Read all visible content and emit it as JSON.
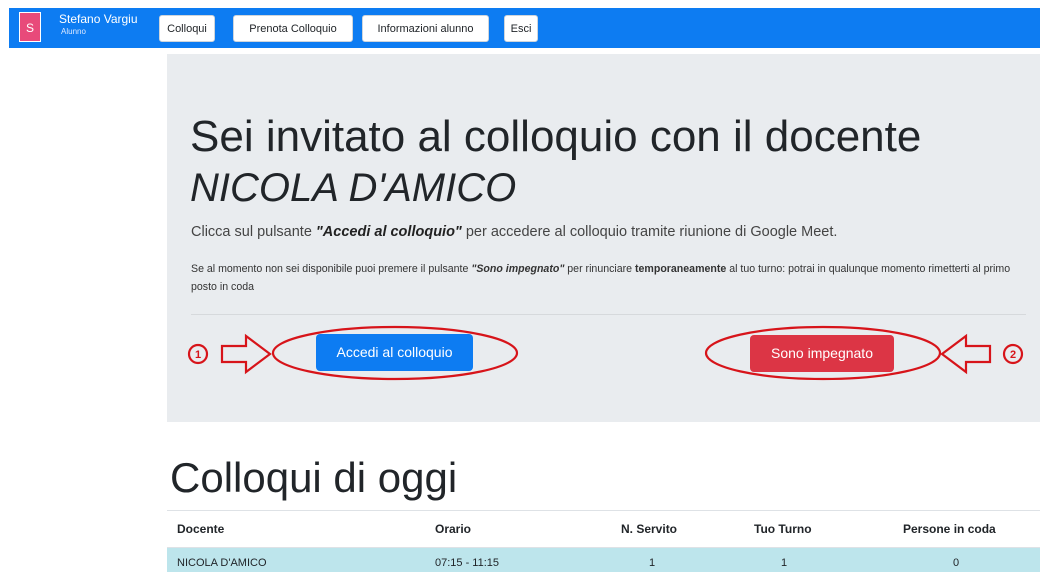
{
  "nav": {
    "avatar_letter": "S",
    "user_name": "Stefano Vargiu",
    "user_role": "Alunno",
    "items": [
      {
        "label": "Colloqui"
      },
      {
        "label": "Prenota Colloquio"
      },
      {
        "label": "Informazioni alunno"
      },
      {
        "label": "Esci"
      }
    ]
  },
  "invite": {
    "title": "Sei invitato al colloquio con il docente",
    "teacher": "NICOLA D'AMICO",
    "lead_pre": "Clicca sul pulsante ",
    "lead_btn": "\"Accedi al colloquio\"",
    "lead_post": " per accedere al colloquio tramite riunione di Google Meet.",
    "info_1": "Se al momento non sei disponibile puoi premere il pulsante ",
    "info_btn": "\"Sono impegnato\"",
    "info_2": " per rinunciare ",
    "info_bold": "temporaneamente",
    "info_3": " al tuo turno: potrai in qualunque momento rimetterti al primo posto in coda",
    "join_button": "Accedi al colloquio",
    "busy_button": "Sono impegnato",
    "marker_1": "1",
    "marker_2": "2"
  },
  "today": {
    "heading": "Colloqui di oggi",
    "columns": [
      "Docente",
      "Orario",
      "N. Servito",
      "Tuo Turno",
      "Persone in coda"
    ],
    "rows": [
      {
        "docente": "NICOLA D'AMICO",
        "orario": "07:15 - 11:15",
        "servito": "1",
        "turno": "1",
        "coda": "0"
      }
    ]
  },
  "colors": {
    "primary": "#0d7cf2",
    "danger": "#dc3545",
    "annotation": "#d7141a",
    "row_highlight": "#bde5ec"
  }
}
